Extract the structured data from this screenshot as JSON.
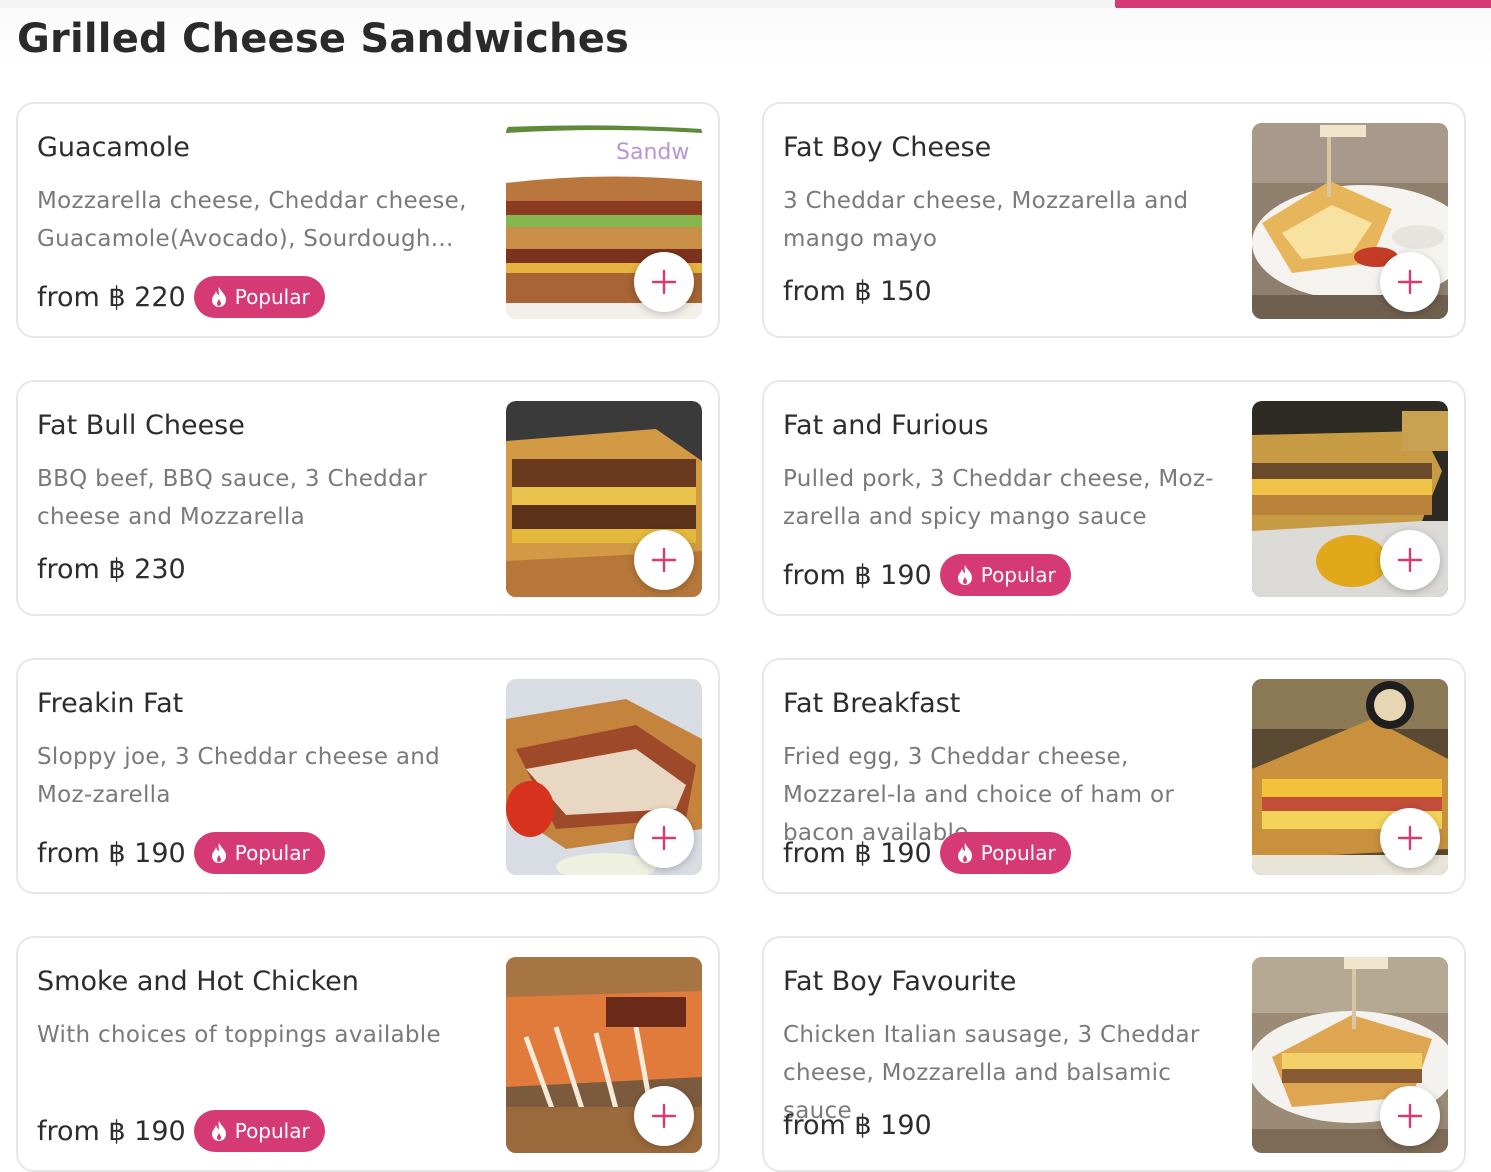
{
  "section": {
    "title": "Grilled Cheese Sandwiches"
  },
  "colors": {
    "accent": "#d63a74",
    "text": "#2d2d2d",
    "muted": "#7a7a7a",
    "border": "#e7e7e7"
  },
  "items": [
    {
      "name": "Guacamole",
      "description": "Mozzarella cheese, Cheddar cheese, Guacamole(Avocado), Sourdough...",
      "price": "from ฿ 220",
      "badge": "Popular",
      "image_overlay_text": "Sandw"
    },
    {
      "name": "Fat Boy Cheese",
      "description": "3 Cheddar cheese, Mozzarella and mango mayo",
      "price": "from ฿ 150",
      "badge": ""
    },
    {
      "name": "Fat Bull Cheese",
      "description": "BBQ beef, BBQ sauce, 3 Cheddar cheese and Mozzarella",
      "price": "from ฿ 230",
      "badge": ""
    },
    {
      "name": "Fat and Furious",
      "description": "Pulled pork, 3 Cheddar cheese, Moz-zarella and spicy mango sauce",
      "price": "from ฿ 190",
      "badge": "Popular"
    },
    {
      "name": "Freakin Fat",
      "description": "Sloppy joe, 3 Cheddar cheese and Moz-zarella",
      "price": "from ฿ 190",
      "badge": "Popular"
    },
    {
      "name": "Fat Breakfast",
      "description": "Fried egg, 3 Cheddar cheese, Mozzarel-la and choice of ham or bacon available",
      "price": "from ฿ 190",
      "badge": "Popular"
    },
    {
      "name": "Smoke and Hot Chicken",
      "description": "With choices of toppings available",
      "price": "from ฿ 190",
      "badge": "Popular"
    },
    {
      "name": "Fat Boy Favourite",
      "description": "Chicken Italian sausage, 3 Cheddar cheese, Mozzarella and balsamic sauce",
      "price": "from ฿ 190",
      "badge": ""
    }
  ]
}
